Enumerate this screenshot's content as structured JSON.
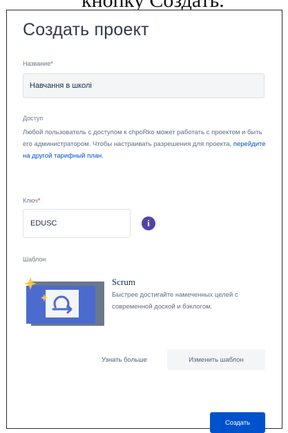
{
  "background_heading_fragment": "кнопку Создать.",
  "dialog": {
    "title": "Создать проект",
    "name_field": {
      "label": "Название",
      "required_mark": "*",
      "value": "Навчання в школі"
    },
    "access": {
      "label": "Доступ",
      "text": "Любой пользователь с доступом к chpoRko может работать с проектом и быть его администратором. Чтобы настраивать разрешения для проекта, ",
      "link": "перейдите на другой тарифный план",
      "text_end": "."
    },
    "key_field": {
      "label": "Ключ",
      "required_mark": "*",
      "value": "EDUSC",
      "info_icon": "info-icon"
    },
    "template": {
      "label": "Шаблон",
      "name": "Scrum",
      "description": "Быстрее достигайте намеченных целей с современной доской и бэклогом.",
      "learn_more": "Узнать больше",
      "change": "Изменить шаблон"
    },
    "create_button": "Создать"
  },
  "colors": {
    "primary": "#0052cc",
    "info": "#5243aa",
    "illustration_blue": "#4c6bce",
    "illustration_gray": "#6b778c",
    "spark": "#f6c542"
  }
}
